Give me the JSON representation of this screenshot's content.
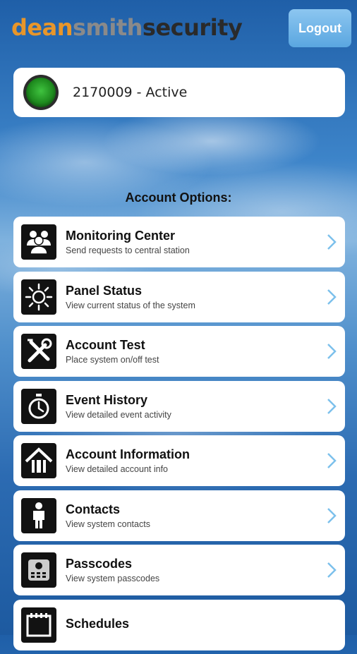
{
  "brand": {
    "part1": "dean",
    "part2": "smith",
    "part3": "security",
    "colors": {
      "dean": "#e8962a",
      "smith": "#8a8a8a",
      "security": "#2a2a2a"
    }
  },
  "header": {
    "logout_label": "Logout"
  },
  "account": {
    "status_text": "2170009 - Active",
    "status_color": "#2aa52a"
  },
  "section": {
    "title": "Account Options:"
  },
  "menu": {
    "items": [
      {
        "title": "Monitoring Center",
        "subtitle": "Send requests to central station",
        "icon": "people-icon"
      },
      {
        "title": "Panel Status",
        "subtitle": "View current status of the system",
        "icon": "sun-icon"
      },
      {
        "title": "Account Test",
        "subtitle": "Place system on/off test",
        "icon": "tools-icon"
      },
      {
        "title": "Event History",
        "subtitle": "View detailed event activity",
        "icon": "stopwatch-icon"
      },
      {
        "title": "Account Information",
        "subtitle": "View detailed account info",
        "icon": "house-icon"
      },
      {
        "title": "Contacts",
        "subtitle": "View system contacts",
        "icon": "person-icon"
      },
      {
        "title": "Passcodes",
        "subtitle": "View system passcodes",
        "icon": "keypad-icon"
      },
      {
        "title": "Schedules",
        "subtitle": "",
        "icon": "calendar-icon"
      }
    ]
  }
}
